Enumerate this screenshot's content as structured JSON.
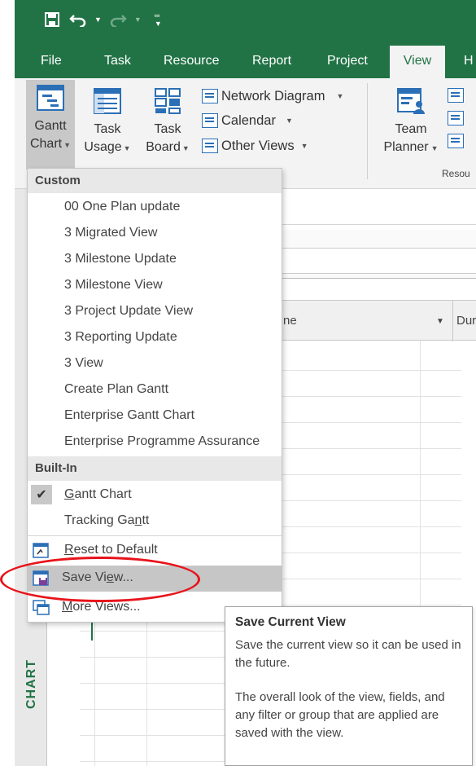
{
  "colors": {
    "accent": "#217346",
    "annotation": "#e8141c",
    "hover": "#c6c6c6"
  },
  "qat": {
    "save_icon": "save-icon",
    "undo_icon": "undo-icon",
    "redo_icon": "redo-icon",
    "customize_icon": "customize-qat-icon"
  },
  "tabs": [
    {
      "label": "File"
    },
    {
      "label": "Task"
    },
    {
      "label": "Resource"
    },
    {
      "label": "Report"
    },
    {
      "label": "Project"
    },
    {
      "label": "View"
    },
    {
      "label": "H"
    }
  ],
  "ribbon": {
    "gantt": {
      "line1": "Gantt",
      "line2": "Chart"
    },
    "task_usage": {
      "line1": "Task",
      "line2": "Usage"
    },
    "task_board": {
      "line1": "Task",
      "line2": "Board"
    },
    "network_diagram": "Network Diagram",
    "calendar": "Calendar",
    "other_views": "Other Views",
    "team_planner": {
      "line1": "Team",
      "line2": "Planner"
    },
    "group_resource": "Resou"
  },
  "sheet": {
    "col_name": "ne",
    "col_duration": "Duration",
    "side_label": "CHART"
  },
  "menu": {
    "custom_header": "Custom",
    "custom_items": [
      "00 One Plan update",
      "3 Migrated View",
      "3 Milestone Update",
      "3 Milestone View",
      "3 Project Update View",
      "3 Reporting Update",
      "3 View",
      "Create Plan Gantt",
      "Enterprise Gantt Chart",
      "Enterprise Programme Assurance"
    ],
    "builtin_header": "Built-In",
    "gantt_chart": {
      "before": "",
      "underlined": "G",
      "after": "antt Chart"
    },
    "tracking_gantt": {
      "before": "Tracking Ga",
      "underlined": "n",
      "after": "tt"
    },
    "reset": {
      "before": "",
      "underlined": "R",
      "after": "eset to Default"
    },
    "save_view": {
      "before": "Save Vi",
      "underlined": "e",
      "after": "w..."
    },
    "more_views": {
      "before": "",
      "underlined": "M",
      "after": "ore Views..."
    }
  },
  "tooltip": {
    "title": "Save Current View",
    "para1": "Save the current view so it can be used in the future.",
    "para2": "The overall look of the view, fields, and any filter or group that are applied are saved with the view."
  }
}
